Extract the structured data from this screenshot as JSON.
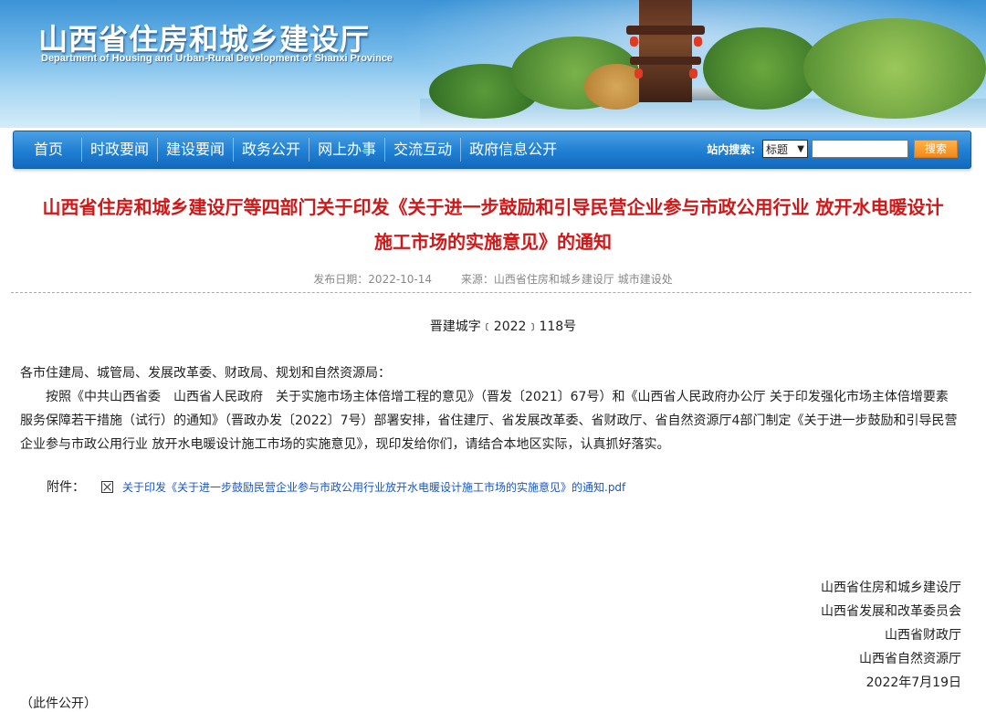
{
  "header": {
    "title": "山西省住房和城乡建设厅",
    "subtitle": "Department of Housing and Urban-Rural Development of Shanxi Province"
  },
  "nav": {
    "items": [
      "首页",
      "时政要闻",
      "建设要闻",
      "政务公开",
      "网上办事",
      "交流互动",
      "政府信息公开"
    ],
    "search_label": "站内搜索:",
    "search_select_value": "标题",
    "search_input_value": "",
    "search_button": "搜索"
  },
  "article": {
    "title_line1": "山西省住房和城乡建设厅等四部门关于印发《关于进一步鼓励和引导民营企业参与市政公用行业 放开水电暖设计",
    "title_line2": "施工市场的实施意见》的通知",
    "publish_date": "发布日期：2022-10-14",
    "source": "来源：山西省住房和城乡建设厅 城市建设处",
    "doc_number": "晋建城字﹝2022﹞118号",
    "salutation": "各市住建局、城管局、发展改革委、财政局、规划和自然资源局：",
    "body": "按照《中共山西省委　山西省人民政府　关于实施市场主体倍增工程的意见》（晋发〔2021〕67号）和《山西省人民政府办公厅 关于印发强化市场主体倍增要素服务保障若干措施（试行）的通知》（晋政办发〔2022〕7号）部署安排，省住建厅、省发展改革委、省财政厅、省自然资源厅4部门制定《关于进一步鼓励和引导民营企业参与市政公用行业 放开水电暖设计施工市场的实施意见》，现印发给你们，请结合本地区实际，认真抓好落实。",
    "attachment_label": "附件：",
    "attachment_link": "关于印发《关于进一步鼓励民营企业参与市政公用行业放开水电暖设计施工市场的实施意见》的通知.pdf",
    "signatures": [
      "山西省住房和城乡建设厅",
      "山西省发展和改革委员会",
      "山西省财政厅",
      "山西省自然资源厅"
    ],
    "date": "2022年7月19日",
    "cutoff_text": "（此件公开）"
  }
}
